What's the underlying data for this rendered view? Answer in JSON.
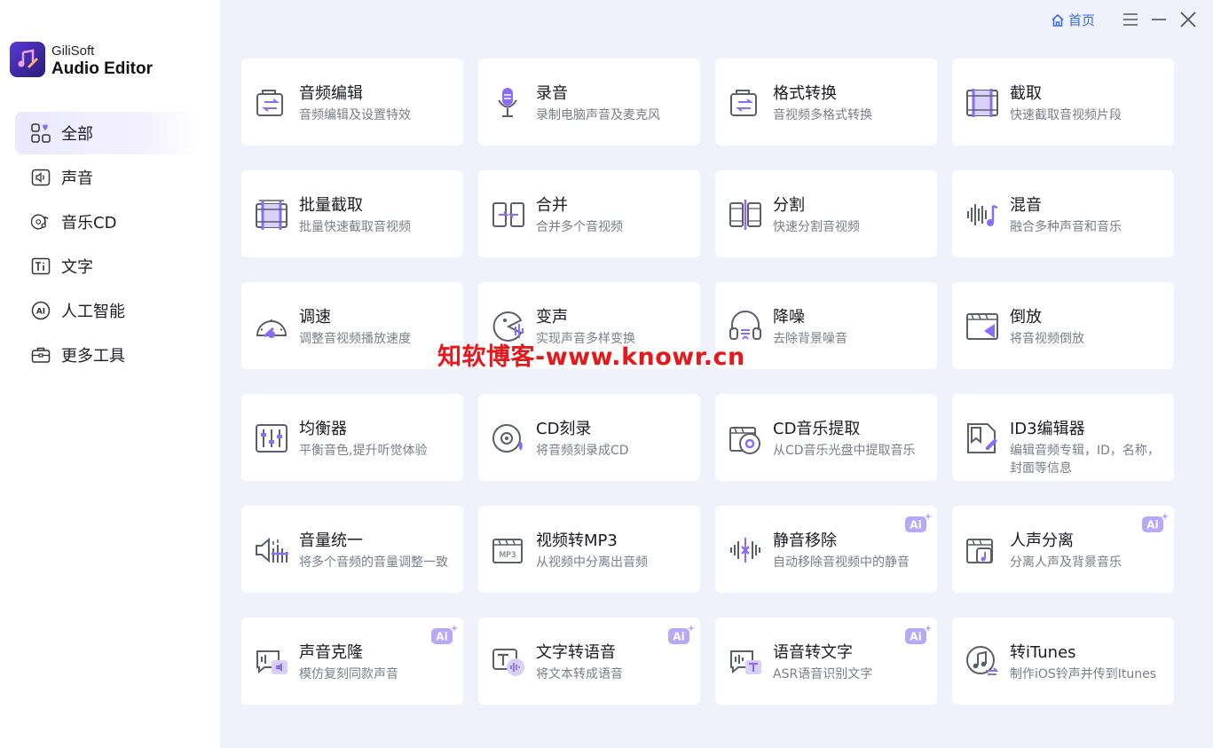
{
  "app": {
    "brand_line1": "GiliSoft",
    "brand_line2": "Audio Editor"
  },
  "header": {
    "home_label": "首页"
  },
  "sidebar": {
    "items": [
      {
        "label": "全部",
        "icon": "grid-icon",
        "active": true
      },
      {
        "label": "声音",
        "icon": "speaker-icon"
      },
      {
        "label": "音乐CD",
        "icon": "music-cd-icon"
      },
      {
        "label": "文字",
        "icon": "text-icon"
      },
      {
        "label": "人工智能",
        "icon": "ai-icon"
      },
      {
        "label": "更多工具",
        "icon": "toolbox-icon"
      }
    ]
  },
  "tools": [
    {
      "title": "音频编辑",
      "desc": "音频编辑及设置特效",
      "icon": "audio-edit-icon"
    },
    {
      "title": "录音",
      "desc": "录制电脑声音及麦克风",
      "icon": "microphone-icon"
    },
    {
      "title": "格式转换",
      "desc": "音视频多格式转换",
      "icon": "format-convert-icon"
    },
    {
      "title": "截取",
      "desc": "快速截取音视频片段",
      "icon": "trim-icon"
    },
    {
      "title": "批量截取",
      "desc": "批量快速截取音视频",
      "icon": "batch-trim-icon"
    },
    {
      "title": "合并",
      "desc": "合并多个音视频",
      "icon": "merge-icon"
    },
    {
      "title": "分割",
      "desc": "快速分割音视频",
      "icon": "split-icon"
    },
    {
      "title": "混音",
      "desc": "融合多种声音和音乐",
      "icon": "mix-icon"
    },
    {
      "title": "调速",
      "desc": "调整音视频播放速度",
      "icon": "speed-icon"
    },
    {
      "title": "变声",
      "desc": "实现声音多样变换",
      "icon": "voice-change-icon"
    },
    {
      "title": "降噪",
      "desc": "去除背景噪音",
      "icon": "noise-reduction-icon"
    },
    {
      "title": "倒放",
      "desc": "将音视频倒放",
      "icon": "reverse-icon"
    },
    {
      "title": "均衡器",
      "desc": "平衡音色,提升听觉体验",
      "icon": "equalizer-icon"
    },
    {
      "title": "CD刻录",
      "desc": "将音频刻录成CD",
      "icon": "cd-burn-icon"
    },
    {
      "title": "CD音乐提取",
      "desc": "从CD音乐光盘中提取音乐",
      "icon": "cd-extract-icon"
    },
    {
      "title": "ID3编辑器",
      "desc": "编辑音频专辑，ID，名称，封面等信息",
      "icon": "id3-editor-icon"
    },
    {
      "title": "音量统一",
      "desc": "将多个音频的音量调整一致",
      "icon": "volume-normalize-icon"
    },
    {
      "title": "视频转MP3",
      "desc": "从视频中分离出音频",
      "icon": "video-to-mp3-icon",
      "mp3_text": "MP3"
    },
    {
      "title": "静音移除",
      "desc": "自动移除音视频中的静音",
      "icon": "silence-remove-icon",
      "ai": true
    },
    {
      "title": "人声分离",
      "desc": "分离人声及背景音乐",
      "icon": "vocal-separate-icon",
      "ai": true
    },
    {
      "title": "声音克隆",
      "desc": "模仿复刻同款声音",
      "icon": "voice-clone-icon",
      "ai": true
    },
    {
      "title": "文字转语音",
      "desc": "将文本转成语音",
      "icon": "text-to-speech-icon",
      "ai": true
    },
    {
      "title": "语音转文字",
      "desc": "ASR语音识别文字",
      "icon": "speech-to-text-icon",
      "ai": true
    },
    {
      "title": "转iTunes",
      "desc": "制作iOS铃声并传到Itunes",
      "icon": "itunes-icon"
    }
  ],
  "ai_badge_text": "Ai",
  "watermark": "知软博客-www.knowr.cn",
  "colors": {
    "accent": "#7b5cf5",
    "link_blue": "#3a6bea",
    "icon_gray": "#5b5e6b",
    "watermark_red": "#e5191b"
  }
}
